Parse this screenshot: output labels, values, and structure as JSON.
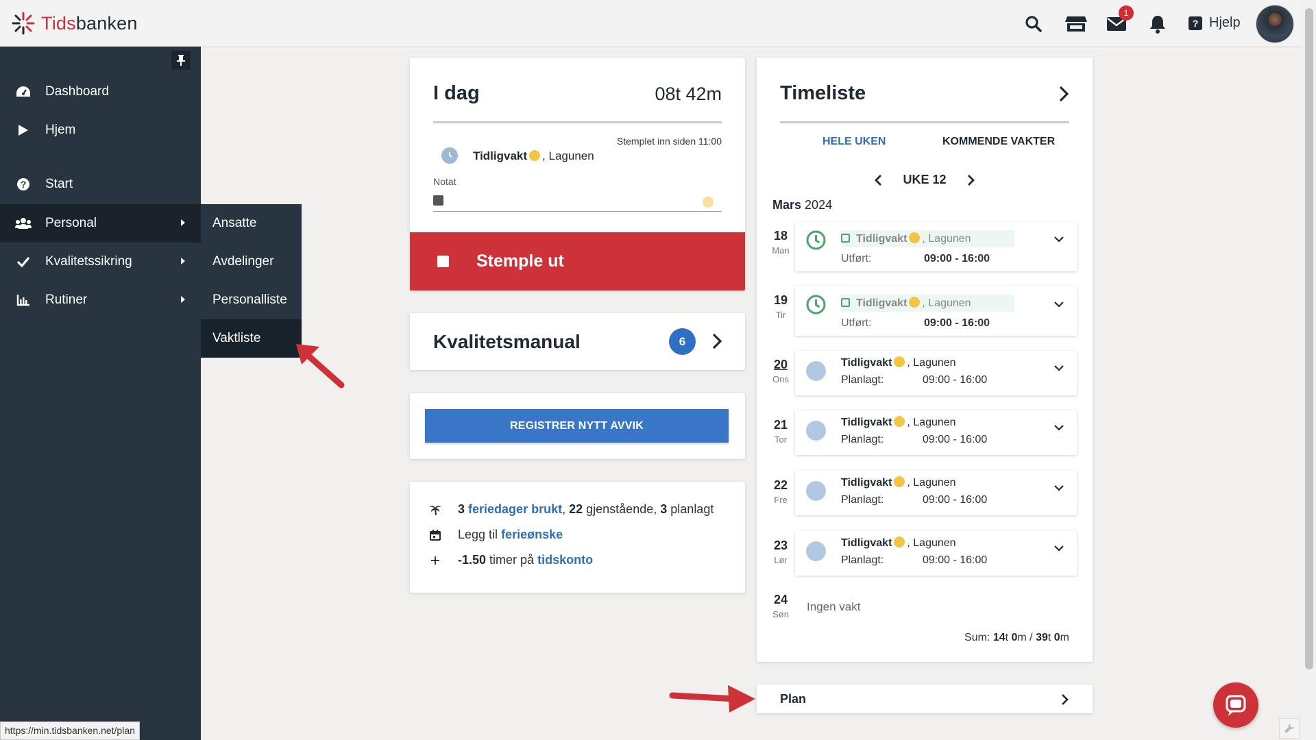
{
  "app": {
    "name_prefix": "Tids",
    "name_suffix": "banken"
  },
  "topbar": {
    "mail_badge": "1",
    "help_label": "Hjelp"
  },
  "sidebar": {
    "items": [
      {
        "label": "Dashboard",
        "icon": "dashboard-icon"
      },
      {
        "label": "Hjem",
        "icon": "play-icon"
      },
      {
        "label": "Start",
        "icon": "question-icon"
      },
      {
        "label": "Personal",
        "icon": "users-icon"
      },
      {
        "label": "Kvalitetssikring",
        "icon": "check-icon"
      },
      {
        "label": "Rutiner",
        "icon": "bar-chart-icon"
      }
    ],
    "submenu": [
      "Ansatte",
      "Avdelinger",
      "Personalliste",
      "Vaktliste"
    ]
  },
  "idag": {
    "title": "I dag",
    "total": "08t 42m",
    "stamped_since": "Stemplet inn siden 11:00",
    "shift_name": "Tidligvakt",
    "location": "Lagunen",
    "note_label": "Notat",
    "stamp_out_label": "Stemple ut"
  },
  "kvalitet": {
    "title": "Kvalitetsmanual",
    "count": "6"
  },
  "avvik": {
    "button_label": "REGISTRER NYTT AVVIK"
  },
  "ferie": {
    "used_count": "3",
    "used_link": "feriedager brukt",
    "remaining_count": "22",
    "remaining_text": "gjenstående,",
    "planned_count": "3",
    "planned_text": "planlagt",
    "wish_prefix": "Legg til",
    "wish_link": "ferieønske",
    "hours_value": "-1.50",
    "hours_text": "timer på",
    "hours_link": "tidskonto"
  },
  "timeliste": {
    "title": "Timeliste",
    "tab_week": "HELE UKEN",
    "tab_upcoming": "KOMMENDE VAKTER",
    "week_label": "UKE 12",
    "month": "Mars",
    "year": "2024",
    "days": [
      {
        "num": "18",
        "name": "Man",
        "shift": "Tidligvakt",
        "location": "Lagunen",
        "label": "Utført:",
        "time": "09:00 - 16:00"
      },
      {
        "num": "19",
        "name": "Tir",
        "shift": "Tidligvakt",
        "location": "Lagunen",
        "label": "Utført:",
        "time": "09:00 - 16:00"
      },
      {
        "num": "20",
        "name": "Ons",
        "shift": "Tidligvakt",
        "location": "Lagunen",
        "label": "Planlagt:",
        "time": "09:00 - 16:00"
      },
      {
        "num": "21",
        "name": "Tor",
        "shift": "Tidligvakt",
        "location": "Lagunen",
        "label": "Planlagt:",
        "time": "09:00 - 16:00"
      },
      {
        "num": "22",
        "name": "Fre",
        "shift": "Tidligvakt",
        "location": "Lagunen",
        "label": "Planlagt:",
        "time": "09:00 - 16:00"
      },
      {
        "num": "23",
        "name": "Lør",
        "shift": "Tidligvakt",
        "location": "Lagunen",
        "label": "Planlagt:",
        "time": "09:00 - 16:00"
      },
      {
        "num": "24",
        "name": "Søn",
        "empty": "Ingen vakt"
      }
    ],
    "sum_label": "Sum:",
    "sum_h1": "14",
    "sum_m1": "0",
    "sum_h2": "39",
    "sum_m2": "0"
  },
  "plan": {
    "label": "Plan"
  },
  "status_url": "https://min.tidsbanken.net/plan",
  "colors": {
    "sidebar": "#283541",
    "accent_red": "#cc3238",
    "accent_blue": "#3a76c7",
    "link_blue": "#2f6fb5",
    "done_green": "#4aa56a"
  }
}
